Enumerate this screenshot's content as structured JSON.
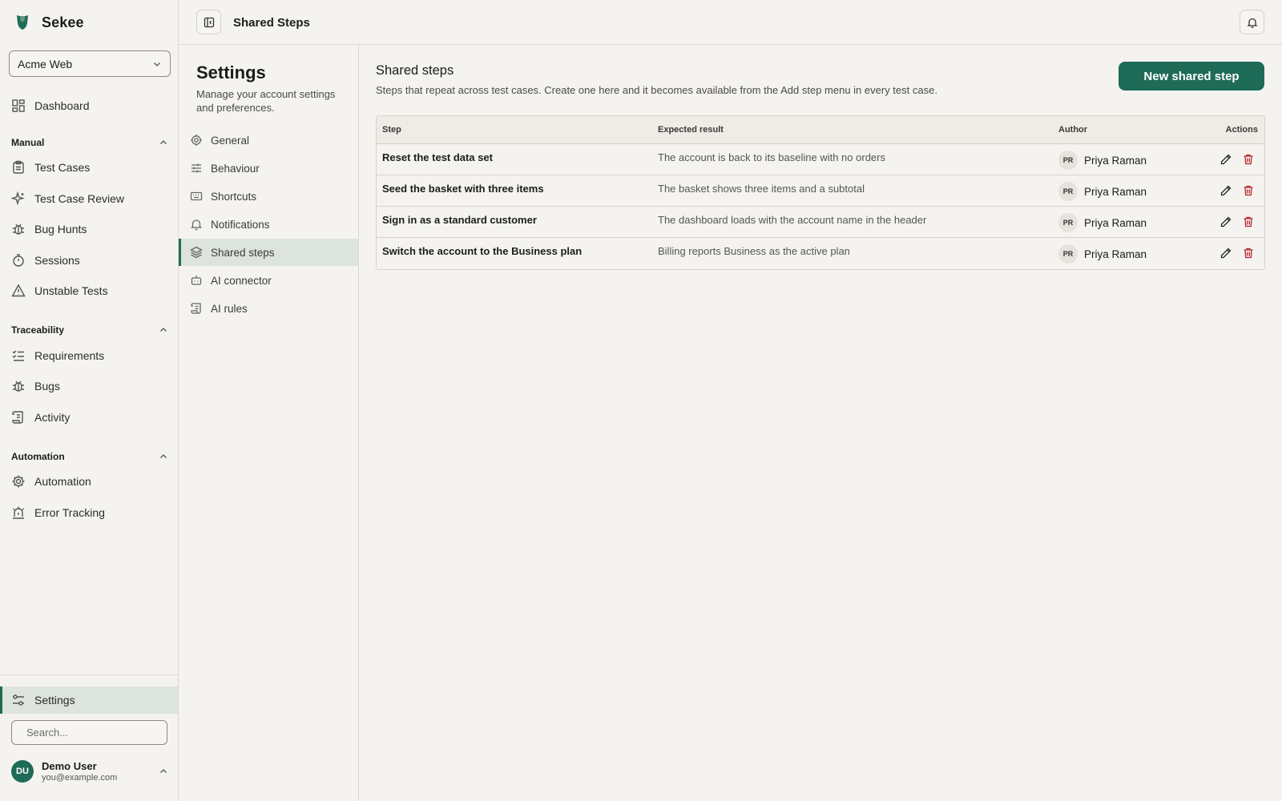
{
  "app": {
    "name": "Sekee"
  },
  "project": {
    "selected": "Acme Web"
  },
  "sidebar": {
    "dashboard": "Dashboard",
    "sections": {
      "manual": {
        "title": "Manual",
        "items": [
          {
            "label": "Test Cases",
            "icon": "clipboard-icon"
          },
          {
            "label": "Test Case Review",
            "icon": "sparkle-icon"
          },
          {
            "label": "Bug Hunts",
            "icon": "bug-icon"
          },
          {
            "label": "Sessions",
            "icon": "timer-icon"
          },
          {
            "label": "Unstable Tests",
            "icon": "warning-icon"
          }
        ]
      },
      "traceability": {
        "title": "Traceability",
        "items": [
          {
            "label": "Requirements",
            "icon": "checklist-icon"
          },
          {
            "label": "Bugs",
            "icon": "bug-icon"
          },
          {
            "label": "Activity",
            "icon": "scroll-icon"
          }
        ]
      },
      "automation": {
        "title": "Automation",
        "items": [
          {
            "label": "Automation",
            "icon": "cog-icon"
          },
          {
            "label": "Error Tracking",
            "icon": "siren-icon"
          }
        ]
      }
    },
    "settings": "Settings",
    "search_placeholder": "Search..."
  },
  "user": {
    "initials": "DU",
    "name": "Demo User",
    "email": "you@example.com"
  },
  "topbar": {
    "title": "Shared Steps"
  },
  "settings_pane": {
    "title": "Settings",
    "subtitle": "Manage your account settings and preferences.",
    "items": [
      {
        "label": "General",
        "icon": "gear-icon"
      },
      {
        "label": "Behaviour",
        "icon": "sliders-icon"
      },
      {
        "label": "Shortcuts",
        "icon": "keyboard-icon"
      },
      {
        "label": "Notifications",
        "icon": "bell-icon"
      },
      {
        "label": "Shared steps",
        "icon": "layers-icon"
      },
      {
        "label": "AI connector",
        "icon": "bot-icon"
      },
      {
        "label": "AI rules",
        "icon": "scroll-icon"
      }
    ]
  },
  "main": {
    "title": "Shared steps",
    "description": "Steps that repeat across test cases. Create one here and it becomes available from the Add step menu in every test case.",
    "new_button": "New shared step",
    "table": {
      "headers": {
        "step": "Step",
        "expected": "Expected result",
        "author": "Author",
        "actions": "Actions"
      },
      "rows": [
        {
          "step": "Reset the test data set",
          "expected": "The account is back to its baseline with no orders",
          "author": "Priya Raman",
          "initials": "PR"
        },
        {
          "step": "Seed the basket with three items",
          "expected": "The basket shows three items and a subtotal",
          "author": "Priya Raman",
          "initials": "PR"
        },
        {
          "step": "Sign in as a standard customer",
          "expected": "The dashboard loads with the account name in the header",
          "author": "Priya Raman",
          "initials": "PR"
        },
        {
          "step": "Switch the account to the Business plan",
          "expected": "Billing reports Business as the active plan",
          "author": "Priya Raman",
          "initials": "PR"
        }
      ]
    }
  },
  "colors": {
    "accent": "#1e6b57",
    "danger": "#b4232a",
    "background": "#f5f3ef"
  }
}
